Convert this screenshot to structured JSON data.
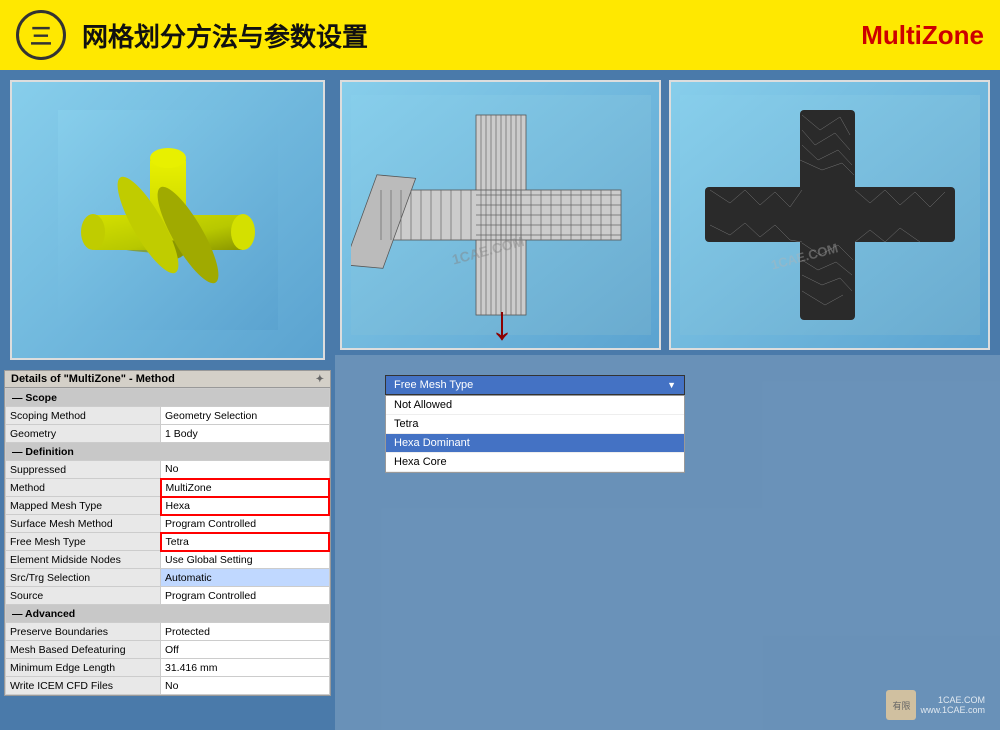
{
  "header": {
    "icon_label": "三",
    "title": "网格划分方法与参数设置",
    "subtitle": "MultiZone"
  },
  "details_panel": {
    "title": "Details of \"MultiZone\" - Method",
    "pin_symbol": "✦",
    "sections": [
      {
        "type": "section",
        "label": "Scope",
        "colspan": true
      },
      {
        "type": "row",
        "col1": "Scoping Method",
        "col2": "Geometry Selection"
      },
      {
        "type": "row",
        "col1": "Geometry",
        "col2": "1 Body"
      },
      {
        "type": "section",
        "label": "Definition",
        "colspan": true
      },
      {
        "type": "row",
        "col1": "Suppressed",
        "col2": "No"
      },
      {
        "type": "row",
        "col1": "Method",
        "col2": "MultiZone",
        "highlight": "red"
      },
      {
        "type": "row",
        "col1": "Mapped Mesh Type",
        "col2": "Hexa",
        "highlight": "red"
      },
      {
        "type": "row",
        "col1": "Surface Mesh Method",
        "col2": "Program Controlled"
      },
      {
        "type": "row",
        "col1": "Free Mesh Type",
        "col2": "Tetra",
        "highlight": "red"
      },
      {
        "type": "row",
        "col1": "Element Midside Nodes",
        "col2": "Use Global Setting"
      },
      {
        "type": "row",
        "col1": "Src/Trg Selection",
        "col2": "Automatic",
        "highlight": "blue-bg"
      },
      {
        "type": "row",
        "col1": "Source",
        "col2": "Program Controlled"
      },
      {
        "type": "section",
        "label": "Advanced",
        "colspan": true
      },
      {
        "type": "row",
        "col1": "Preserve Boundaries",
        "col2": "Protected"
      },
      {
        "type": "row",
        "col1": "Mesh Based Defeaturing",
        "col2": "Off"
      },
      {
        "type": "row",
        "col1": "Minimum Edge Length",
        "col2": "31.416 mm"
      },
      {
        "type": "row",
        "col1": "Write ICEM CFD Files",
        "col2": "No"
      }
    ]
  },
  "dropdown": {
    "label": "Free Mesh Type",
    "options": [
      {
        "label": "Not Allowed",
        "selected": false
      },
      {
        "label": "Tetra",
        "selected": false
      },
      {
        "label": "Hexa Dominant",
        "selected": true
      },
      {
        "label": "Hexa Core",
        "selected": false
      }
    ]
  },
  "watermark": {
    "line1": "1CAE.COM",
    "line2": "www.1CAE.com"
  }
}
